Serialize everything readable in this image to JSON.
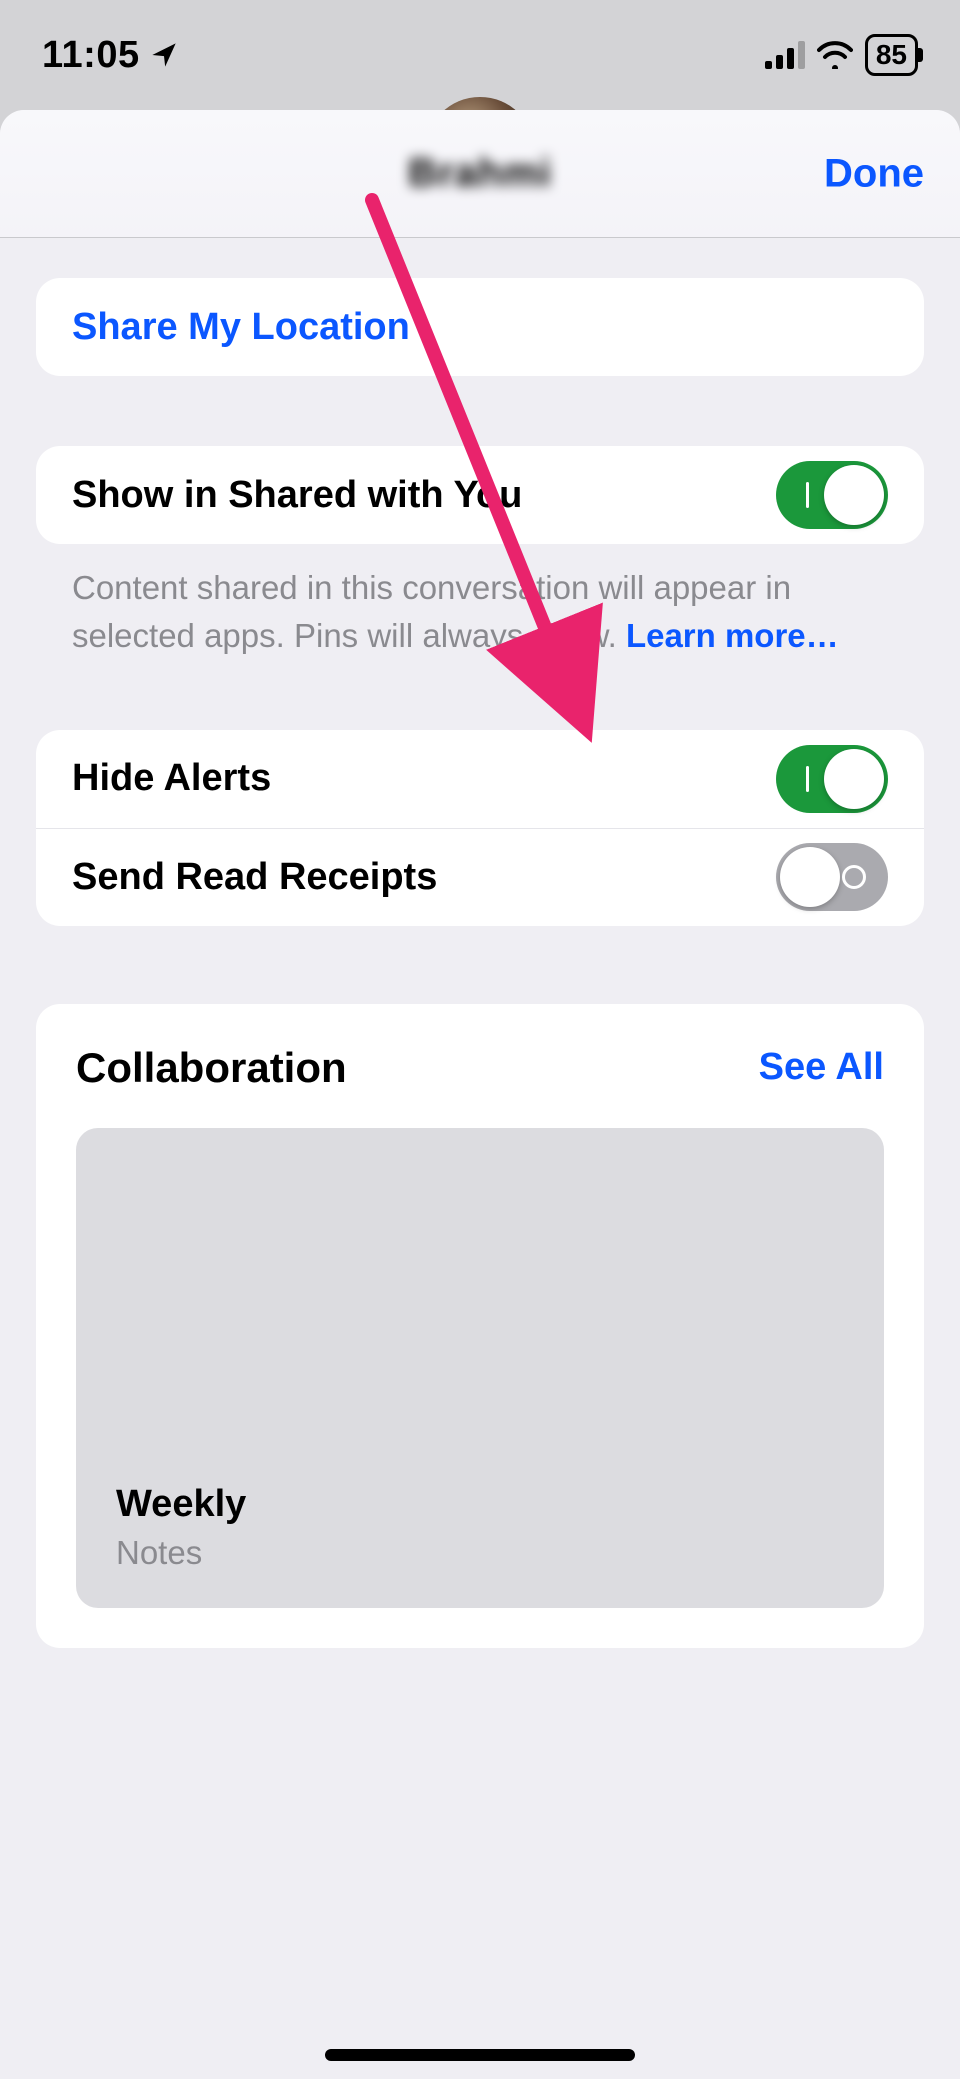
{
  "status_bar": {
    "time": "11:05",
    "battery_pct": "85"
  },
  "sheet": {
    "title": "Brahmi",
    "done_label": "Done"
  },
  "share_location": {
    "label": "Share My Location"
  },
  "shared_with_you": {
    "label": "Show in Shared with You",
    "on": true,
    "footnote_pre": "Content shared in this conversation will appear in selected apps. Pins will always show. ",
    "learn_more": "Learn more…"
  },
  "alerts": {
    "hide_alerts_label": "Hide Alerts",
    "hide_alerts_on": true,
    "read_receipts_label": "Send Read Receipts",
    "read_receipts_on": false
  },
  "collaboration": {
    "title": "Collaboration",
    "see_all": "See All",
    "items": [
      {
        "title": "Weekly",
        "subtitle": "Notes"
      }
    ]
  },
  "annotation": {
    "arrow_color": "#e9236c"
  }
}
